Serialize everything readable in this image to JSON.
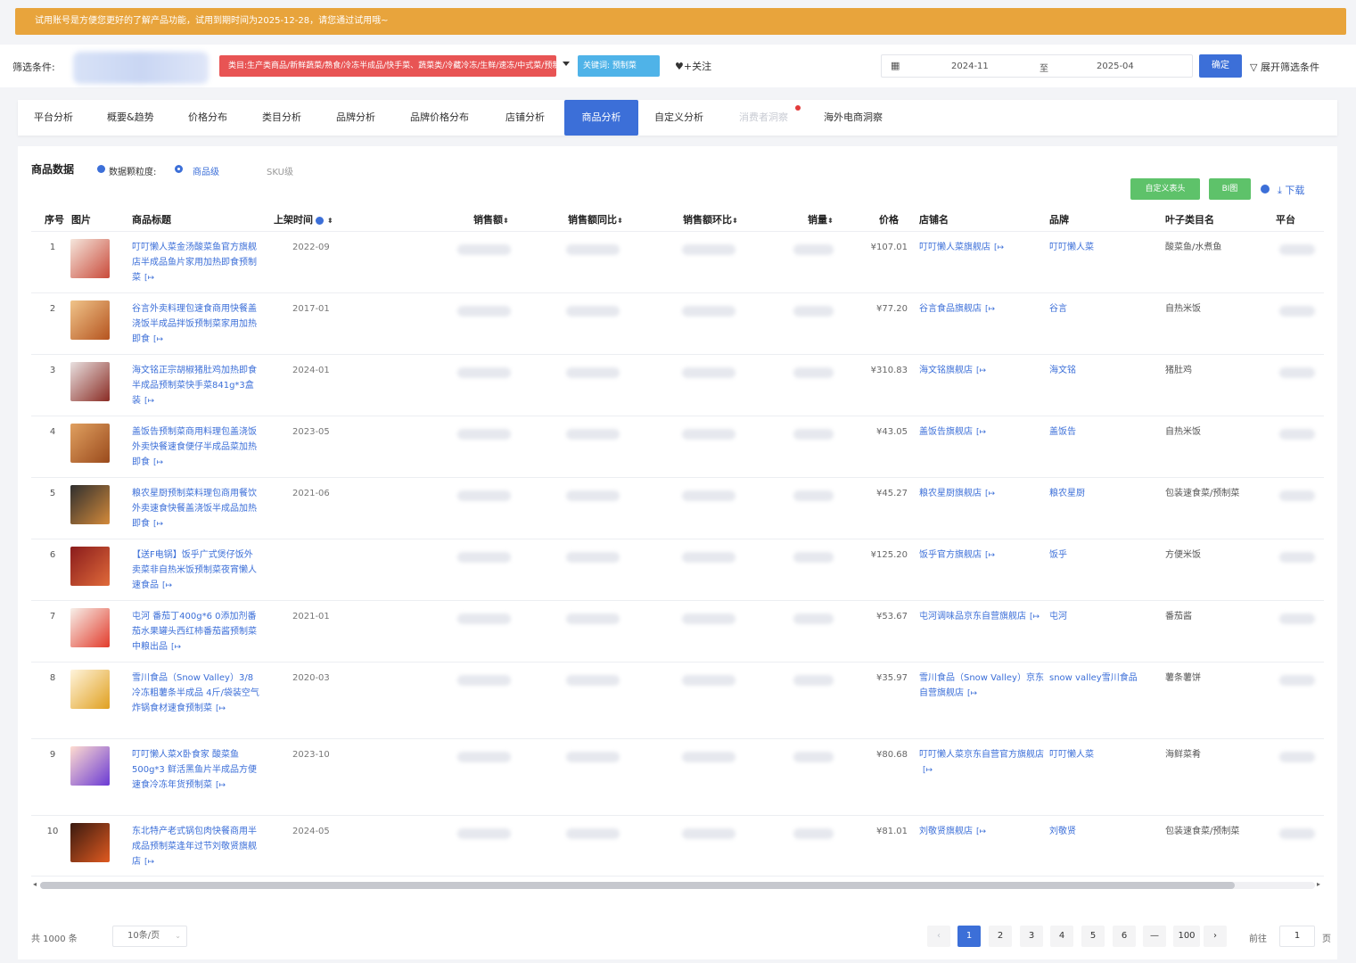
{
  "banner": "试用账号是方便您更好的了解产品功能，试用到期时间为2025-12-28，请您通过试用哦~",
  "filter": {
    "label": "筛选条件:",
    "category_tag": "类目:生产类商品/新鲜蔬菜/熟食/冷冻半成品/快手菜、蔬菜类/冷藏冷冻/生鲜/速冻/中式菜/预制菜",
    "keyword_tag": "关键词: 预制菜",
    "follow_label": "+关注",
    "date_start": "2024-11",
    "date_to": "至",
    "date_end": "2025-04",
    "confirm_label": "确定",
    "expand_label": "展开筛选条件"
  },
  "tabs": [
    {
      "label": "平台分析"
    },
    {
      "label": "概要&趋势"
    },
    {
      "label": "价格分布"
    },
    {
      "label": "类目分析"
    },
    {
      "label": "品牌分析"
    },
    {
      "label": "品牌价格分布"
    },
    {
      "label": "店铺分析"
    },
    {
      "label": "商品分析"
    },
    {
      "label": "自定义分析"
    },
    {
      "label": "消费者洞察"
    },
    {
      "label": "海外电商洞察"
    }
  ],
  "panel": {
    "title": "商品数据",
    "granularity_label": "数据颗粒度:",
    "option_product": "商品级",
    "option_sku": "SKU级",
    "custom_header_label": "自定义表头",
    "bi_label": "BI图",
    "download_label": "下载"
  },
  "table": {
    "headers": {
      "idx": "序号",
      "img": "图片",
      "title": "商品标题",
      "date": "上架时间",
      "sales": "销售额",
      "yoy": "销售额同比",
      "mom": "销售额环比",
      "volume": "销量",
      "price": "价格",
      "shop": "店铺名",
      "brand": "品牌",
      "leaf": "叶子类目名",
      "platform": "平台"
    },
    "rows": [
      {
        "idx": "1",
        "title": "叮叮懒人菜金汤酸菜鱼官方旗舰店半成品鱼片家用加热即食预制菜",
        "date": "2022-09",
        "price": "¥107.01",
        "shop": "叮叮懒人菜旗舰店",
        "brand": "叮叮懒人菜",
        "leaf": "酸菜鱼/水煮鱼"
      },
      {
        "idx": "2",
        "title": "谷言外卖料理包速食商用快餐盖浇饭半成品拌饭预制菜家用加热即食",
        "date": "2017-01",
        "price": "¥77.20",
        "shop": "谷言食品旗舰店",
        "brand": "谷言",
        "leaf": "自热米饭"
      },
      {
        "idx": "3",
        "title": "海文铭正宗胡椒猪肚鸡加热即食半成品预制菜快手菜841g*3盒装",
        "date": "2024-01",
        "price": "¥310.83",
        "shop": "海文铭旗舰店",
        "brand": "海文铭",
        "leaf": "猪肚鸡"
      },
      {
        "idx": "4",
        "title": "盖饭告预制菜商用料理包盖浇饭外卖快餐速食便仔半成品菜加热即食",
        "date": "2023-05",
        "price": "¥43.05",
        "shop": "盖饭告旗舰店",
        "brand": "盖饭告",
        "leaf": "自热米饭"
      },
      {
        "idx": "5",
        "title": "粮农星厨预制菜料理包商用餐饮外卖速食快餐盖浇饭半成品加热即食",
        "date": "2021-06",
        "price": "¥45.27",
        "shop": "粮农星厨旗舰店",
        "brand": "粮农星厨",
        "leaf": "包装速食菜/预制菜"
      },
      {
        "idx": "6",
        "title": "【送F电锅】饭乎广式煲仔饭外卖菜非自热米饭预制菜夜宵懒人速食品",
        "date": "",
        "price": "¥125.20",
        "shop": "饭乎官方旗舰店",
        "brand": "饭乎",
        "leaf": "方便米饭"
      },
      {
        "idx": "7",
        "title": "屯河 番茄丁400g*6 0添加剂番茄水果罐头西红柿番茄酱预制菜 中粮出品",
        "date": "2021-01",
        "price": "¥53.67",
        "shop": "屯河调味品京东自营旗舰店",
        "brand": "屯河",
        "leaf": "番茄酱"
      },
      {
        "idx": "8",
        "title": "雪川食品（Snow Valley）3/8冷冻粗薯条半成品 4斤/袋装空气炸锅食材速食预制菜",
        "date": "2020-03",
        "price": "¥35.97",
        "shop": "雪川食品（Snow Valley）京东自营旗舰店",
        "brand": "snow valley雪川食品",
        "leaf": "薯条薯饼"
      },
      {
        "idx": "9",
        "title": "叮叮懒人菜X卧食家 酸菜鱼 500g*3 鲜活黑鱼片半成品方便速食冷冻年货预制菜",
        "date": "2023-10",
        "price": "¥80.68",
        "shop": "叮叮懒人菜京东自营官方旗舰店",
        "brand": "叮叮懒人菜",
        "leaf": "海鲜菜肴"
      },
      {
        "idx": "10",
        "title": "东北特产老式锅包肉快餐商用半成品预制菜逢年过节刘敬贤旗舰店",
        "date": "2024-05",
        "price": "¥81.01",
        "shop": "刘敬贤旗舰店",
        "brand": "刘敬贤",
        "leaf": "包装速食菜/预制菜"
      }
    ]
  },
  "pager": {
    "total": "共 1000 条",
    "page_size": "10条/页",
    "pages": [
      "1",
      "2",
      "3",
      "4",
      "5",
      "6",
      "—",
      "100"
    ],
    "goto_label": "前往",
    "goto_value": "1",
    "page_unit": "页"
  },
  "colors": {
    "primary": "#3c6fd8",
    "banner": "#e8a43c",
    "red_tag": "#e85454",
    "keyword_tag": "#4fb3e8",
    "green_button": "#5ec26a"
  }
}
